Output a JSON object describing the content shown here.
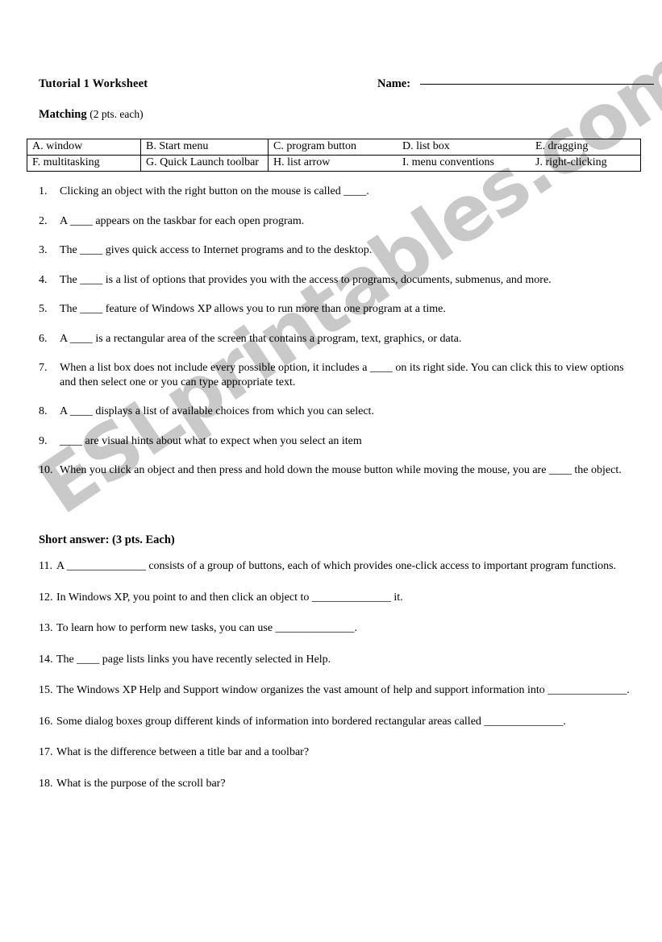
{
  "header": {
    "doc_title": "Tutorial 1 Worksheet",
    "name_label": "Name:"
  },
  "matching_section": {
    "heading": "Matching",
    "points_note": "(2 pts. each)"
  },
  "word_bank": {
    "row1": [
      "A. window",
      "B. Start menu",
      "C. program button",
      "D. list box",
      "E. dragging"
    ],
    "row2": [
      "F. multitasking",
      "G. Quick Launch toolbar",
      "H. list arrow",
      "I. menu conventions",
      "J. right-clicking"
    ]
  },
  "matching_questions": [
    {
      "num": "1.",
      "text": "Clicking an object with the right button on the mouse is called ____."
    },
    {
      "num": "2.",
      "text": "A ____ appears on the taskbar for each open program."
    },
    {
      "num": "3.",
      "text": "The ____ gives quick access to Internet programs and to the desktop."
    },
    {
      "num": "4.",
      "text": "The ____ is a list of options that provides you with the access to programs, documents, submenus, and more."
    },
    {
      "num": "5.",
      "text": "The ____ feature of Windows XP allows you to run more than one program at a time."
    },
    {
      "num": "6.",
      "text": "A ____ is a rectangular area of the screen that contains a program, text, graphics, or data."
    },
    {
      "num": "7.",
      "text": "When a list box does not include every possible option, it includes a ____ on its right side. You can click this to view options and then select one or you can type appropriate text."
    },
    {
      "num": "8.",
      "text": "A ____ displays a list of available choices from which you can select."
    },
    {
      "num": "9.",
      "text": "____ are visual hints about what to expect when you select an item"
    },
    {
      "num": "10.",
      "text": "When you click an object and then press and hold down the mouse button while moving the mouse, you are ____ the object."
    }
  ],
  "short_answer_section": {
    "heading": "Short answer: (3 pts. Each)"
  },
  "short_answer_questions": [
    {
      "num": "11.",
      "text": "A ______________ consists of a group of buttons, each of which provides one-click access to important program functions."
    },
    {
      "num": "12.",
      "text": "In Windows XP, you point to and then click an object to ______________ it."
    },
    {
      "num": "13.",
      "text": "To learn how to perform new tasks, you can use ______________."
    },
    {
      "num": "14.",
      "text": "The ____ page lists links you have recently selected in Help."
    },
    {
      "num": "15.",
      "text": "The Windows XP Help and Support window organizes the vast amount of help and support information into ______________."
    },
    {
      "num": "16.",
      "text": "Some dialog boxes group different kinds of information into bordered rectangular areas called ______________."
    },
    {
      "num": "17.",
      "text": "What is the difference between a title bar and a toolbar?"
    },
    {
      "num": "18.",
      "text": "What is the purpose of the scroll bar?"
    }
  ],
  "watermark": {
    "text": "ESLprintables.com",
    "color": "#c9c9c9"
  }
}
